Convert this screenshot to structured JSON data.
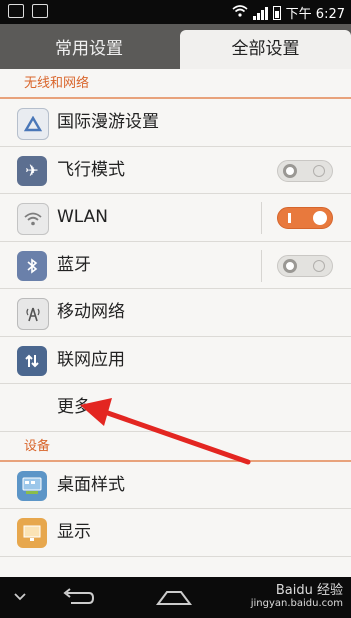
{
  "status_bar": {
    "time": "下午 6:27",
    "icons": [
      "chat-icon",
      "image-icon",
      "wifi-icon",
      "signal-icon",
      "battery-icon"
    ]
  },
  "tabs": [
    {
      "label": "常用设置",
      "active": false
    },
    {
      "label": "全部设置",
      "active": true
    }
  ],
  "sections": {
    "wireless": {
      "header": "无线和网络",
      "items": [
        {
          "label": "国际漫游设置",
          "icon": "international-roaming-icon"
        },
        {
          "label": "飞行模式",
          "icon": "airplane-icon",
          "toggle": "off"
        },
        {
          "label": "WLAN",
          "icon": "wifi-icon",
          "toggle": "on"
        },
        {
          "label": "蓝牙",
          "icon": "bluetooth-icon",
          "toggle": "off"
        },
        {
          "label": "移动网络",
          "icon": "mobile-network-icon"
        },
        {
          "label": "联网应用",
          "icon": "network-apps-icon"
        },
        {
          "label": "更多"
        }
      ]
    },
    "device": {
      "header": "设备",
      "items": [
        {
          "label": "桌面样式",
          "icon": "desktop-style-icon"
        },
        {
          "label": "显示",
          "icon": "display-icon"
        }
      ]
    }
  },
  "watermark": {
    "text": "Baidu 经验",
    "sub": "jingyan.baidu.com"
  },
  "colors": {
    "accent": "#e8793d",
    "section_header": "#d9652b",
    "annotation_arrow": "#e32621"
  }
}
